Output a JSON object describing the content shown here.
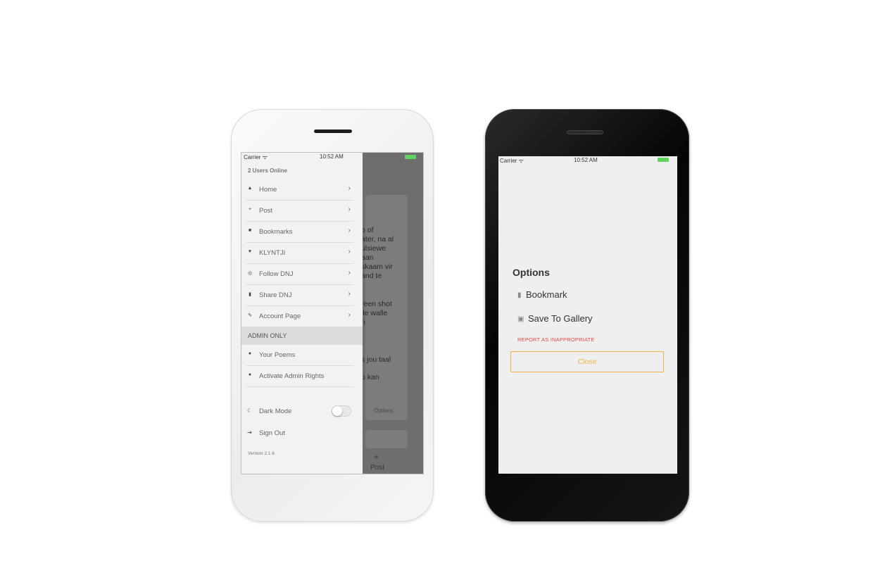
{
  "phone_left": {
    "status_bar": {
      "carrier": "Carrier ᯤ",
      "time": "10:52 AM"
    },
    "drawer": {
      "online_text": "2 Users Online",
      "menu_items": [
        {
          "label": "Home",
          "icon": "home-icon",
          "glyph": "▲"
        },
        {
          "label": "Post",
          "icon": "plus-icon",
          "glyph": "+"
        },
        {
          "label": "Bookmarks",
          "icon": "book-icon",
          "glyph": "■"
        },
        {
          "label": "KLYNTJI",
          "icon": "heart-icon",
          "glyph": "♥"
        },
        {
          "label": "Follow DNJ",
          "icon": "instagram-icon",
          "glyph": "◎"
        },
        {
          "label": "Share DNJ",
          "icon": "share-icon",
          "glyph": "▮"
        },
        {
          "label": "Account Page",
          "icon": "brush-icon",
          "glyph": "✎"
        }
      ],
      "admin_header": "ADMIN ONLY",
      "admin_items": [
        {
          "label": "Your Poems",
          "icon": "user-icon",
          "glyph": "●"
        },
        {
          "label": "Activate Admin Rights",
          "icon": "user-icon",
          "glyph": "●"
        }
      ],
      "dark_mode": {
        "label": "Dark Mode",
        "icon": "moon-icon",
        "glyph": "☾",
        "enabled": false
      },
      "sign_out": {
        "label": "Sign Out",
        "icon": "sign-out-icon",
        "glyph": "⇥"
      },
      "version": "Version 2.1.6"
    },
    "background_feed": {
      "text_lines_1": "o of\nater, na al\nulsiewe\naan\nskaam vir\nand te",
      "text_lines_2": "reen shot\nlle walle\nn",
      "text_line_3": "s jou taal",
      "text_line_4": "o kan",
      "options_label": "Options",
      "tab_icon": "+",
      "tab_label": "Post"
    }
  },
  "phone_right": {
    "status_bar": {
      "carrier": "Carrier ᯤ",
      "time": "10:52 AM"
    },
    "options_sheet": {
      "title": "Options",
      "bookmark_label": "Bookmark",
      "bookmark_glyph": "▮",
      "save_label": "Save To Gallery",
      "save_glyph": "▣",
      "report_label": "REPORT AS INAPPROPRIATE",
      "close_label": "Close"
    }
  },
  "colors": {
    "accent_orange": "#f0b24a",
    "report_red": "#e04848",
    "battery_green": "#5fd35f"
  }
}
